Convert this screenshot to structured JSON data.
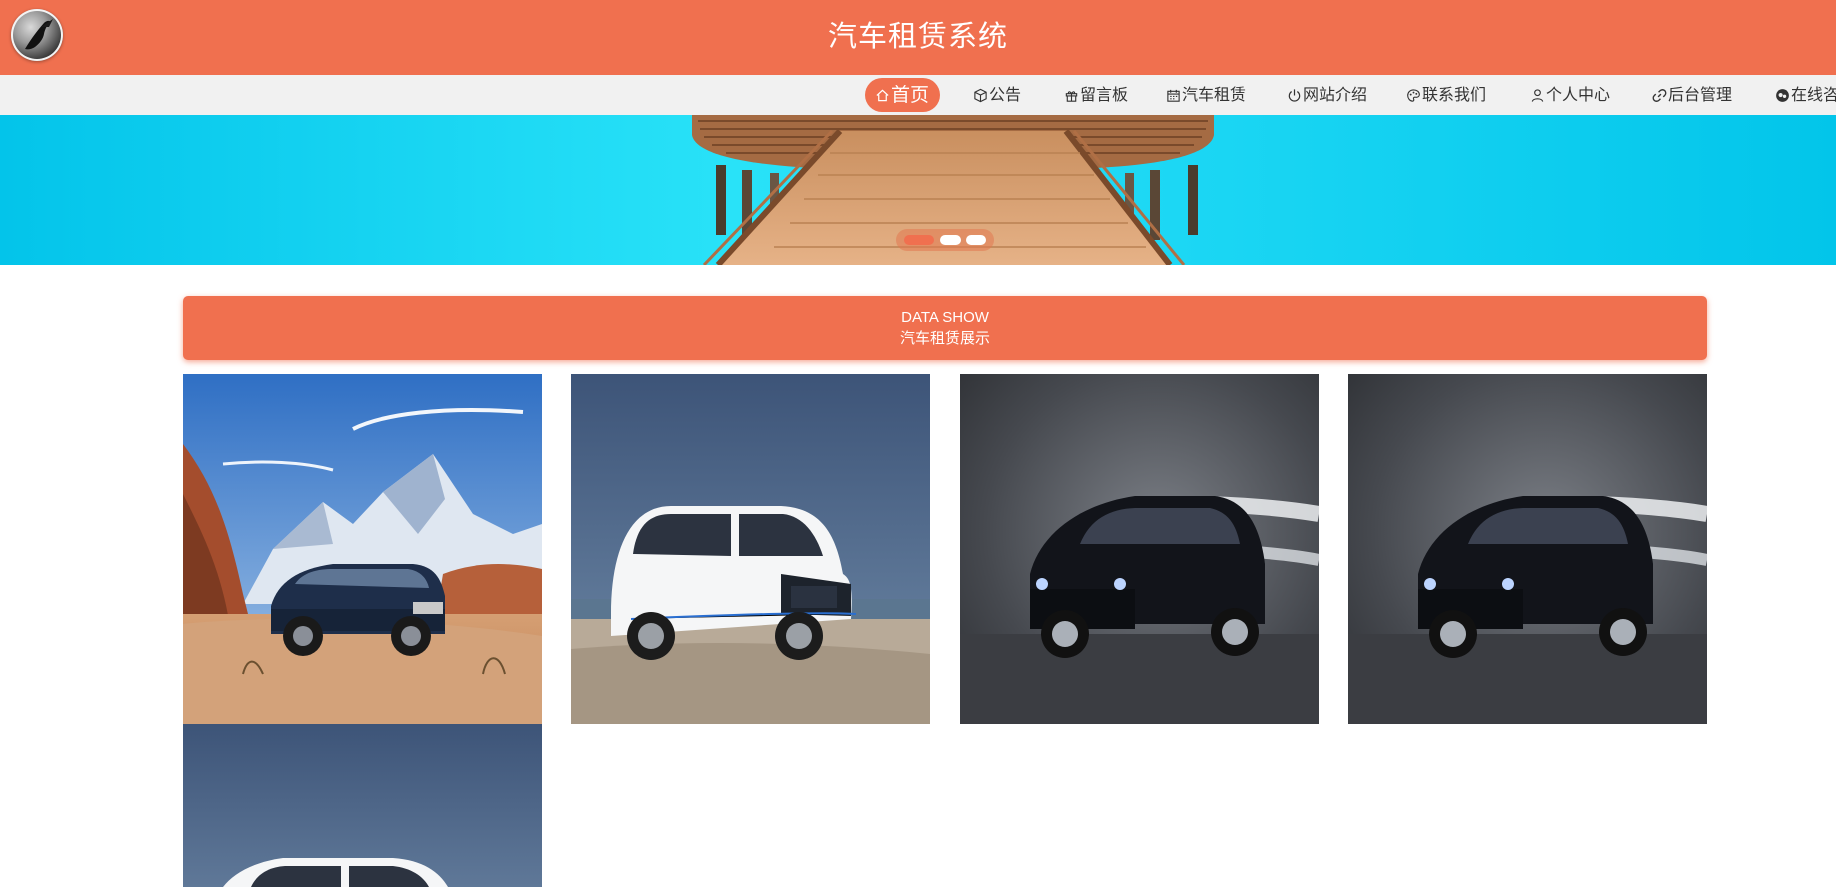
{
  "header": {
    "title": "汽车租赁系统",
    "logo_icon": "bird-silhouette-logo"
  },
  "nav": {
    "items": [
      {
        "label": "首页",
        "icon": "home-icon",
        "active": true
      },
      {
        "label": "公告",
        "icon": "cube-icon"
      },
      {
        "label": "留言板",
        "icon": "gift-icon"
      },
      {
        "label": "汽车租赁",
        "icon": "calendar-icon"
      },
      {
        "label": "网站介绍",
        "icon": "power-icon"
      },
      {
        "label": "联系我们",
        "icon": "palette-icon"
      },
      {
        "label": "个人中心",
        "icon": "user-icon"
      },
      {
        "label": "后台管理",
        "icon": "link-icon"
      },
      {
        "label": "在线咨",
        "icon": "chat-icon"
      }
    ]
  },
  "banner": {
    "slides": 3,
    "active_slide": 1
  },
  "section": {
    "title_en": "DATA SHOW",
    "title_cn": "汽车租赁展示"
  },
  "cars": [
    {
      "scene": "blue SUV in desert with snowy mountains"
    },
    {
      "scene": "white MPV on seaside road"
    },
    {
      "scene": "black SUV on dark studio floor"
    },
    {
      "scene": "black SUV on dark studio floor"
    },
    {
      "scene": "white MPV on seaside road"
    }
  ],
  "colors": {
    "accent": "#f0704f",
    "nav_bg": "#f1f1f1",
    "banner_sea": "#1ad8f4"
  }
}
